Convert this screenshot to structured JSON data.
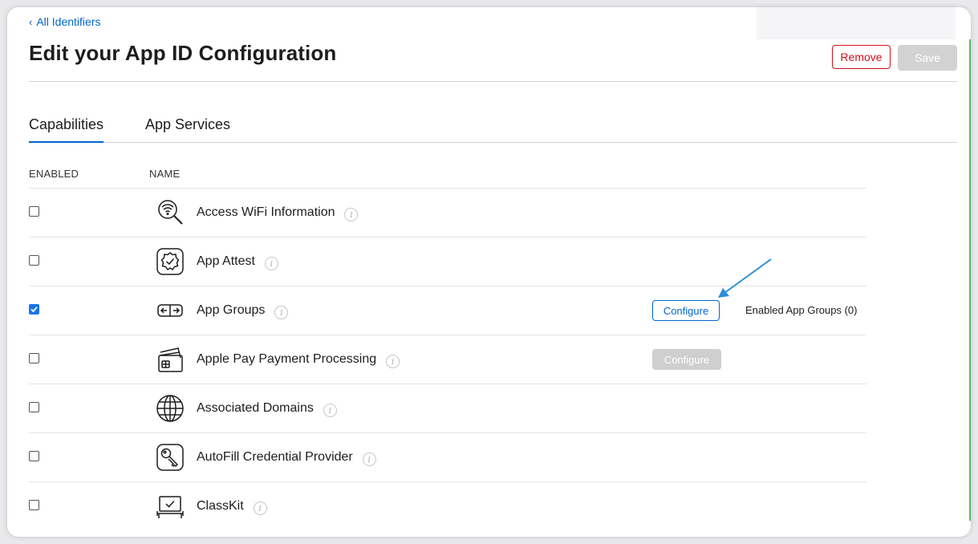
{
  "nav": {
    "back_label": "All Identifiers"
  },
  "header": {
    "title": "Edit your App ID Configuration",
    "remove_label": "Remove",
    "save_label": "Save"
  },
  "tabs": [
    {
      "label": "Capabilities",
      "active": true
    },
    {
      "label": "App Services",
      "active": false
    }
  ],
  "table": {
    "headers": {
      "enabled": "ENABLED",
      "name": "NAME"
    },
    "rows": [
      {
        "name": "Access WiFi Information",
        "enabled": false,
        "icon": "wifi-search-icon"
      },
      {
        "name": "App Attest",
        "enabled": false,
        "icon": "badge-check-icon"
      },
      {
        "name": "App Groups",
        "enabled": true,
        "icon": "app-groups-icon",
        "configure_label": "Configure",
        "status": "Enabled App Groups (0)"
      },
      {
        "name": "Apple Pay Payment Processing",
        "enabled": false,
        "icon": "payment-card-icon",
        "configure_label": "Configure"
      },
      {
        "name": "Associated Domains",
        "enabled": false,
        "icon": "globe-icon"
      },
      {
        "name": "AutoFill Credential Provider",
        "enabled": false,
        "icon": "key-icon"
      },
      {
        "name": "ClassKit",
        "enabled": false,
        "icon": "classkit-icon"
      }
    ]
  },
  "colors": {
    "accent": "#0066cc",
    "danger": "#d30f1b",
    "arrow": "#2a8fd8"
  }
}
